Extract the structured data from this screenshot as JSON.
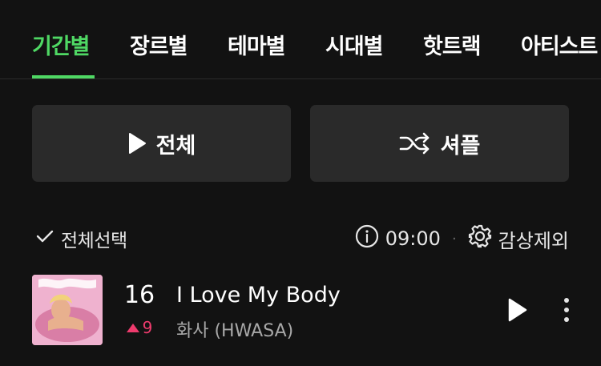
{
  "tabs": [
    {
      "label": "기간별",
      "active": true
    },
    {
      "label": "장르별",
      "active": false
    },
    {
      "label": "테마별",
      "active": false
    },
    {
      "label": "시대별",
      "active": false
    },
    {
      "label": "핫트랙",
      "active": false
    },
    {
      "label": "아티스트",
      "active": false
    }
  ],
  "actions": {
    "play_all_label": "전체",
    "shuffle_label": "셔플"
  },
  "toolbar": {
    "select_all_label": "전체선택",
    "timer_value": "09:00",
    "exclude_label": "감상제외"
  },
  "tracks": [
    {
      "rank": "16",
      "change": "9",
      "change_direction": "up",
      "title": "I Love My Body",
      "artist": "화사 (HWASA)"
    }
  ],
  "colors": {
    "accent": "#4fd864",
    "rank_up": "#ee3b6d",
    "background": "#121212",
    "button_bg": "#2a2a2a"
  },
  "icons": [
    "play-icon",
    "shuffle-icon",
    "check-icon",
    "info-icon",
    "gear-icon",
    "more-vertical-icon"
  ]
}
